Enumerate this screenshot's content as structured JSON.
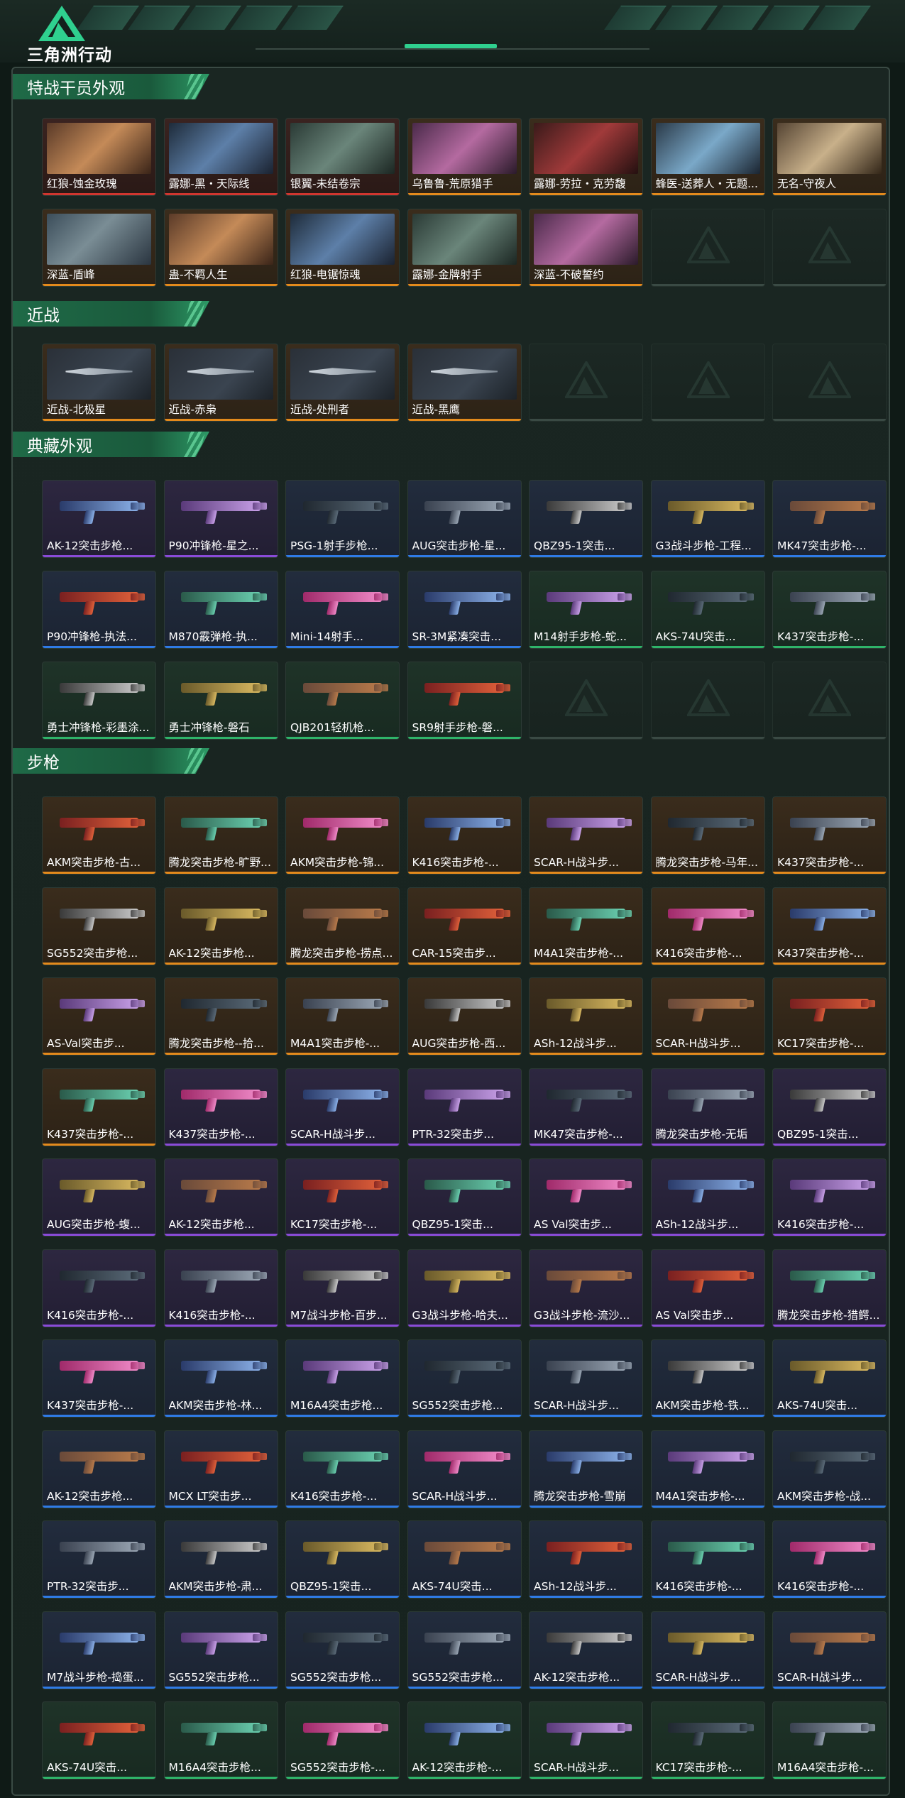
{
  "header": {
    "logo_text": "三角洲行动",
    "logo_icon": "delta-triangle-logo"
  },
  "rarity_colors": {
    "red": "#d2362f",
    "gold": "#e48a1c",
    "purple": "#8a4bd8",
    "blue": "#2f7be6",
    "green": "#2fb46a"
  },
  "sections": [
    {
      "title": "特战干员外观",
      "items": [
        {
          "label": "红狼-蚀金玫瑰",
          "rarity": "red"
        },
        {
          "label": "露娜-黑・天际线",
          "rarity": "red"
        },
        {
          "label": "银翼-未结卷宗",
          "rarity": "red"
        },
        {
          "label": "乌鲁鲁-荒原猎手",
          "rarity": "gold"
        },
        {
          "label": "露娜-劳拉・克劳馥",
          "rarity": "gold"
        },
        {
          "label": "蜂医-送葬人・无题...",
          "rarity": "gold"
        },
        {
          "label": "无名-守夜人",
          "rarity": "gold"
        },
        {
          "label": "深蓝-盾峰",
          "rarity": "gold"
        },
        {
          "label": "蛊-不羁人生",
          "rarity": "gold"
        },
        {
          "label": "红狼-电锯惊魂",
          "rarity": "gold"
        },
        {
          "label": "露娜-金牌射手",
          "rarity": "gold"
        },
        {
          "label": "深蓝-不破誓约",
          "rarity": "gold"
        }
      ]
    },
    {
      "title": "近战",
      "items": [
        {
          "label": "近战-北极星",
          "rarity": "gold"
        },
        {
          "label": "近战-赤枭",
          "rarity": "gold"
        },
        {
          "label": "近战-处刑者",
          "rarity": "gold"
        },
        {
          "label": "近战-黑鹰",
          "rarity": "gold"
        }
      ]
    },
    {
      "title": "典藏外观",
      "items": [
        {
          "label": "AK-12突击步枪...",
          "rarity": "purple"
        },
        {
          "label": "P90冲锋枪-星之...",
          "rarity": "purple"
        },
        {
          "label": "PSG-1射手步枪...",
          "rarity": "blue"
        },
        {
          "label": "AUG突击步枪-星...",
          "rarity": "blue"
        },
        {
          "label": "QBZ95-1突击...",
          "rarity": "blue"
        },
        {
          "label": "G3战斗步枪-工程...",
          "rarity": "blue"
        },
        {
          "label": "MK47突击步枪-...",
          "rarity": "blue"
        },
        {
          "label": "P90冲锋枪-执法...",
          "rarity": "blue"
        },
        {
          "label": "M870霰弹枪-执...",
          "rarity": "blue"
        },
        {
          "label": "Mini-14射手...",
          "rarity": "blue"
        },
        {
          "label": "SR-3M紧凑突击...",
          "rarity": "blue"
        },
        {
          "label": "M14射手步枪-蛇...",
          "rarity": "green"
        },
        {
          "label": "AKS-74U突击...",
          "rarity": "green"
        },
        {
          "label": "K437突击步枪-...",
          "rarity": "green"
        },
        {
          "label": "勇士冲锋枪-彩墨涂...",
          "rarity": "green"
        },
        {
          "label": "勇士冲锋枪-磐石",
          "rarity": "green"
        },
        {
          "label": "QJB201轻机枪...",
          "rarity": "green"
        },
        {
          "label": "SR9射手步枪-磐...",
          "rarity": "green"
        }
      ]
    },
    {
      "title": "步枪",
      "items": [
        {
          "label": "AKM突击步枪-古...",
          "rarity": "gold"
        },
        {
          "label": "腾龙突击步枪-旷野...",
          "rarity": "gold"
        },
        {
          "label": "AKM突击步枪-锦...",
          "rarity": "gold"
        },
        {
          "label": "K416突击步枪-...",
          "rarity": "gold"
        },
        {
          "label": "SCAR-H战斗步...",
          "rarity": "gold"
        },
        {
          "label": "腾龙突击步枪-马年...",
          "rarity": "gold"
        },
        {
          "label": "K437突击步枪-...",
          "rarity": "gold"
        },
        {
          "label": "SG552突击步枪...",
          "rarity": "gold"
        },
        {
          "label": "AK-12突击步枪...",
          "rarity": "gold"
        },
        {
          "label": "腾龙突击步枪-捞点...",
          "rarity": "gold"
        },
        {
          "label": "CAR-15突击步...",
          "rarity": "gold"
        },
        {
          "label": "M4A1突击步枪-...",
          "rarity": "gold"
        },
        {
          "label": "K416突击步枪-...",
          "rarity": "gold"
        },
        {
          "label": "K437突击步枪-...",
          "rarity": "gold"
        },
        {
          "label": "AS-Val突击步...",
          "rarity": "gold"
        },
        {
          "label": "腾龙突击步枪--拾...",
          "rarity": "gold"
        },
        {
          "label": "M4A1突击步枪-...",
          "rarity": "gold"
        },
        {
          "label": "AUG突击步枪-西...",
          "rarity": "gold"
        },
        {
          "label": "ASh-12战斗步...",
          "rarity": "gold"
        },
        {
          "label": "SCAR-H战斗步...",
          "rarity": "gold"
        },
        {
          "label": "KC17突击步枪-...",
          "rarity": "gold"
        },
        {
          "label": "K437突击步枪-...",
          "rarity": "gold"
        },
        {
          "label": "K437突击步枪-...",
          "rarity": "purple"
        },
        {
          "label": "SCAR-H战斗步...",
          "rarity": "purple"
        },
        {
          "label": "PTR-32突击步...",
          "rarity": "purple"
        },
        {
          "label": "MK47突击步枪-...",
          "rarity": "purple"
        },
        {
          "label": "腾龙突击步枪-无垢",
          "rarity": "purple"
        },
        {
          "label": "QBZ95-1突击...",
          "rarity": "purple"
        },
        {
          "label": "AUG突击步枪-蝮...",
          "rarity": "purple"
        },
        {
          "label": "AK-12突击步枪...",
          "rarity": "purple"
        },
        {
          "label": "KC17突击步枪-...",
          "rarity": "purple"
        },
        {
          "label": "QBZ95-1突击...",
          "rarity": "purple"
        },
        {
          "label": "AS Val突击步...",
          "rarity": "purple"
        },
        {
          "label": "ASh-12战斗步...",
          "rarity": "purple"
        },
        {
          "label": "K416突击步枪-...",
          "rarity": "purple"
        },
        {
          "label": "K416突击步枪-...",
          "rarity": "purple"
        },
        {
          "label": "K416突击步枪-...",
          "rarity": "purple"
        },
        {
          "label": "M7战斗步枪-百步...",
          "rarity": "purple"
        },
        {
          "label": "G3战斗步枪-哈夫...",
          "rarity": "purple"
        },
        {
          "label": "G3战斗步枪-流沙...",
          "rarity": "purple"
        },
        {
          "label": "AS Val突击步...",
          "rarity": "purple"
        },
        {
          "label": "腾龙突击步枪-猎鳄...",
          "rarity": "purple"
        },
        {
          "label": "K437突击步枪-...",
          "rarity": "blue"
        },
        {
          "label": "AKM突击步枪-林...",
          "rarity": "blue"
        },
        {
          "label": "M16A4突击步枪...",
          "rarity": "blue"
        },
        {
          "label": "SG552突击步枪...",
          "rarity": "blue"
        },
        {
          "label": "SCAR-H战斗步...",
          "rarity": "blue"
        },
        {
          "label": "AKM突击步枪-铁...",
          "rarity": "blue"
        },
        {
          "label": "AKS-74U突击...",
          "rarity": "blue"
        },
        {
          "label": "AK-12突击步枪...",
          "rarity": "blue"
        },
        {
          "label": "MCX LT突击步...",
          "rarity": "blue"
        },
        {
          "label": "K416突击步枪-...",
          "rarity": "blue"
        },
        {
          "label": "SCAR-H战斗步...",
          "rarity": "blue"
        },
        {
          "label": "腾龙突击步枪-雪崩",
          "rarity": "blue"
        },
        {
          "label": "M4A1突击步枪-...",
          "rarity": "blue"
        },
        {
          "label": "AKM突击步枪-战...",
          "rarity": "blue"
        },
        {
          "label": "PTR-32突击步...",
          "rarity": "blue"
        },
        {
          "label": "AKM突击步枪-肃...",
          "rarity": "blue"
        },
        {
          "label": "QBZ95-1突击...",
          "rarity": "blue"
        },
        {
          "label": "AKS-74U突击...",
          "rarity": "blue"
        },
        {
          "label": "ASh-12战斗步...",
          "rarity": "blue"
        },
        {
          "label": "K416突击步枪-...",
          "rarity": "blue"
        },
        {
          "label": "K416突击步枪-...",
          "rarity": "blue"
        },
        {
          "label": "M7战斗步枪-捣蛋...",
          "rarity": "blue"
        },
        {
          "label": "SG552突击步枪...",
          "rarity": "blue"
        },
        {
          "label": "SG552突击步枪...",
          "rarity": "blue"
        },
        {
          "label": "SG552突击步枪...",
          "rarity": "blue"
        },
        {
          "label": "AK-12突击步枪...",
          "rarity": "blue"
        },
        {
          "label": "SCAR-H战斗步...",
          "rarity": "blue"
        },
        {
          "label": "SCAR-H战斗步...",
          "rarity": "blue"
        },
        {
          "label": "AKS-74U突击...",
          "rarity": "green"
        },
        {
          "label": "M16A4突击步枪...",
          "rarity": "green"
        },
        {
          "label": "SG552突击步枪-...",
          "rarity": "green"
        },
        {
          "label": "AK-12突击步枪-...",
          "rarity": "green"
        },
        {
          "label": "SCAR-H战斗步...",
          "rarity": "green"
        },
        {
          "label": "KC17突击步枪-...",
          "rarity": "green"
        },
        {
          "label": "M16A4突击步枪-...",
          "rarity": "green"
        }
      ]
    }
  ]
}
